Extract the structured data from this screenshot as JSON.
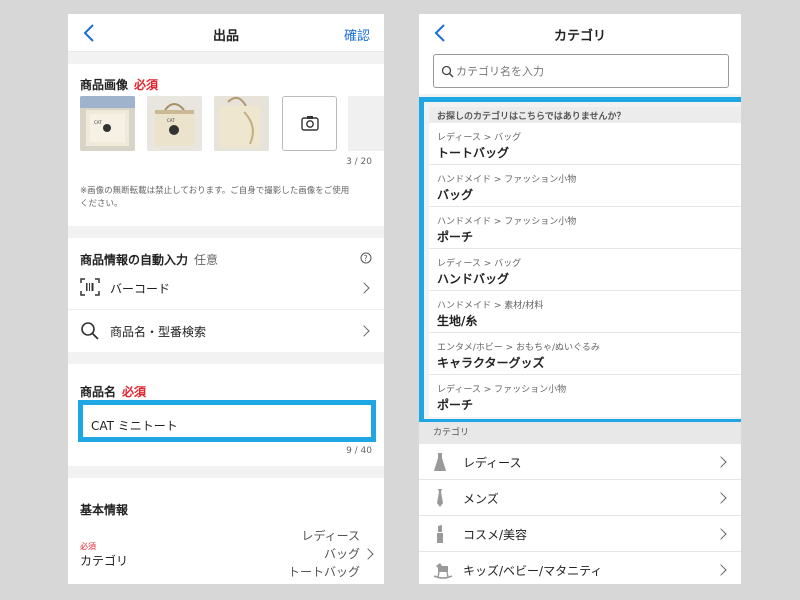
{
  "left": {
    "header": {
      "title": "出品",
      "confirm_label": "確認"
    },
    "images": {
      "label": "商品画像",
      "required": "必須",
      "counter": "3 / 20",
      "note": "※画像の無断転載は禁止しております。ご自身で撮影した画像をご使用ください。"
    },
    "autofill": {
      "label": "商品情報の自動入力",
      "optional": "任意",
      "items": [
        {
          "label": "バーコード",
          "icon": "barcode-icon"
        },
        {
          "label": "商品名・型番検索",
          "icon": "search-icon"
        }
      ]
    },
    "name": {
      "label": "商品名",
      "required": "必須",
      "value": "CAT ミニトート",
      "counter": "9 / 40"
    },
    "basic": {
      "label": "基本情報",
      "category_required": "必須",
      "category_label": "カテゴリ",
      "category_path": [
        "レディース",
        "バッグ",
        "トートバッグ"
      ]
    }
  },
  "right": {
    "header": {
      "title": "カテゴリ"
    },
    "search": {
      "placeholder": "カテゴリ名を入力"
    },
    "suggestions_title": "お探しのカテゴリはこちらではありませんか？",
    "suggestions": [
      {
        "path": "レディース > バッグ",
        "name": "トートバッグ"
      },
      {
        "path": "ハンドメイド > ファッション小物",
        "name": "バッグ"
      },
      {
        "path": "ハンドメイド > ファッション小物",
        "name": "ポーチ"
      },
      {
        "path": "レディース > バッグ",
        "name": "ハンドバッグ"
      },
      {
        "path": "ハンドメイド > 素材/材料",
        "name": "生地/糸"
      },
      {
        "path": "エンタメ/ホビー > おもちゃ/ぬいぐるみ",
        "name": "キャラクターグッズ"
      },
      {
        "path": "レディース > ファッション小物",
        "name": "ポーチ"
      }
    ],
    "categories_title": "カテゴリ",
    "categories": [
      {
        "label": "レディース",
        "icon": "dress-icon"
      },
      {
        "label": "メンズ",
        "icon": "necktie-icon"
      },
      {
        "label": "コスメ/美容",
        "icon": "lipstick-icon"
      },
      {
        "label": "キッズ/ベビー/マタニティ",
        "icon": "rocking-horse-icon"
      }
    ]
  },
  "colors": {
    "accent": "#1a6fd6",
    "required": "#e2242e",
    "highlight": "#1ea7e3"
  }
}
